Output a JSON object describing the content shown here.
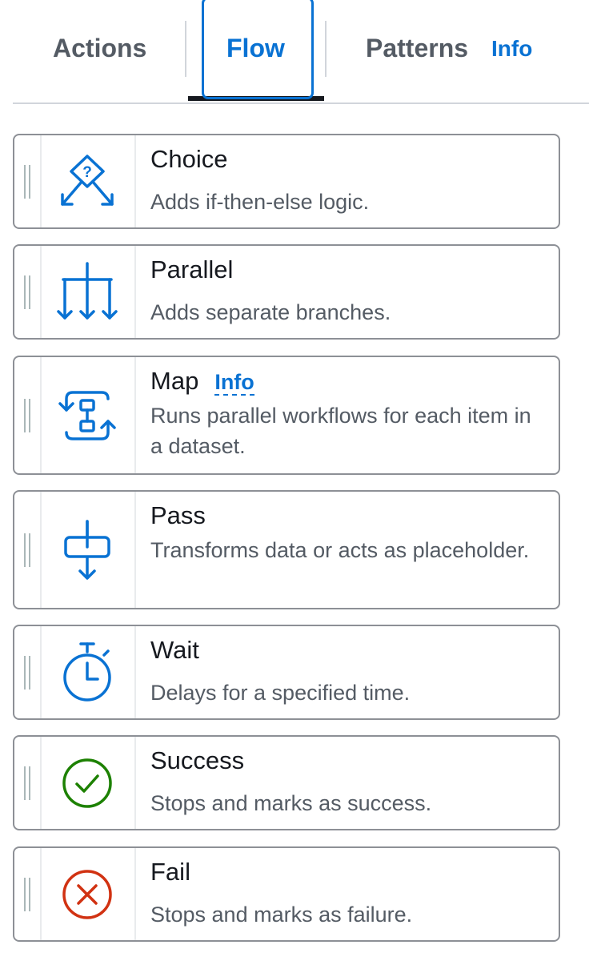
{
  "tabs": {
    "actions": "Actions",
    "flow": "Flow",
    "patterns": "Patterns",
    "info": "Info",
    "active": "flow"
  },
  "colors": {
    "accent": "#0972d3",
    "success": "#1d8102",
    "error": "#d13212",
    "border": "#8d9096"
  },
  "states": [
    {
      "title": "Choice",
      "description": "Adds if-then-else logic.",
      "icon": "choice-icon"
    },
    {
      "title": "Parallel",
      "description": "Adds separate branches.",
      "icon": "parallel-icon"
    },
    {
      "title": "Map",
      "info": "Info",
      "description": "Runs parallel workflows for each item in a dataset.",
      "icon": "map-icon"
    },
    {
      "title": "Pass",
      "description": "Transforms data or acts as placeholder.",
      "icon": "pass-icon"
    },
    {
      "title": "Wait",
      "description": "Delays for a specified time.",
      "icon": "stopwatch-icon"
    },
    {
      "title": "Success",
      "description": "Stops and marks as success.",
      "icon": "check-circle-icon"
    },
    {
      "title": "Fail",
      "description": "Stops and marks as failure.",
      "icon": "x-circle-icon"
    }
  ]
}
